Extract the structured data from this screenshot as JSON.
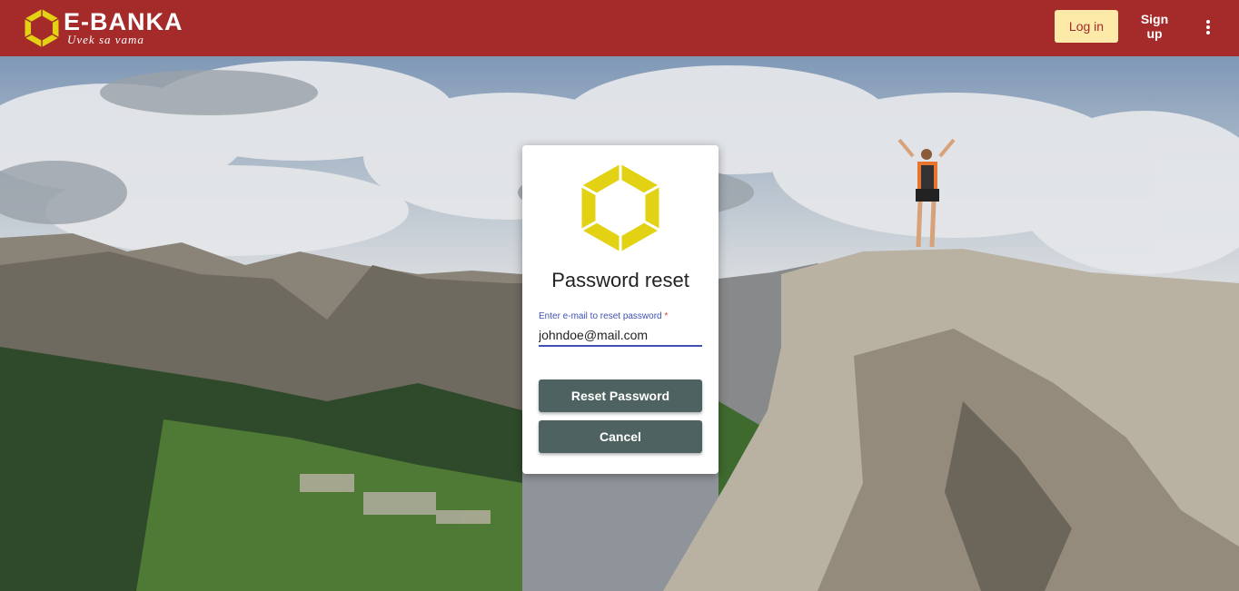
{
  "header": {
    "brand_name": "E-BANKA",
    "brand_tagline": "Uvek sa vama",
    "login_label": "Log in",
    "signup_label": "Sign up",
    "menu_icon": "more-vert-icon",
    "colors": {
      "bar": "#a52a2a",
      "login_bg": "#fdeaa8",
      "logo": "#e2d213"
    }
  },
  "card": {
    "title": "Password reset",
    "email_label": "Enter e-mail to reset password",
    "required_mark": "*",
    "email_value": "johndoe@mail.com",
    "reset_label": "Reset Password",
    "cancel_label": "Cancel",
    "logo_icon": "e-banka-logo-icon",
    "colors": {
      "button": "#4e6361",
      "field_accent": "#3f51b5"
    }
  }
}
